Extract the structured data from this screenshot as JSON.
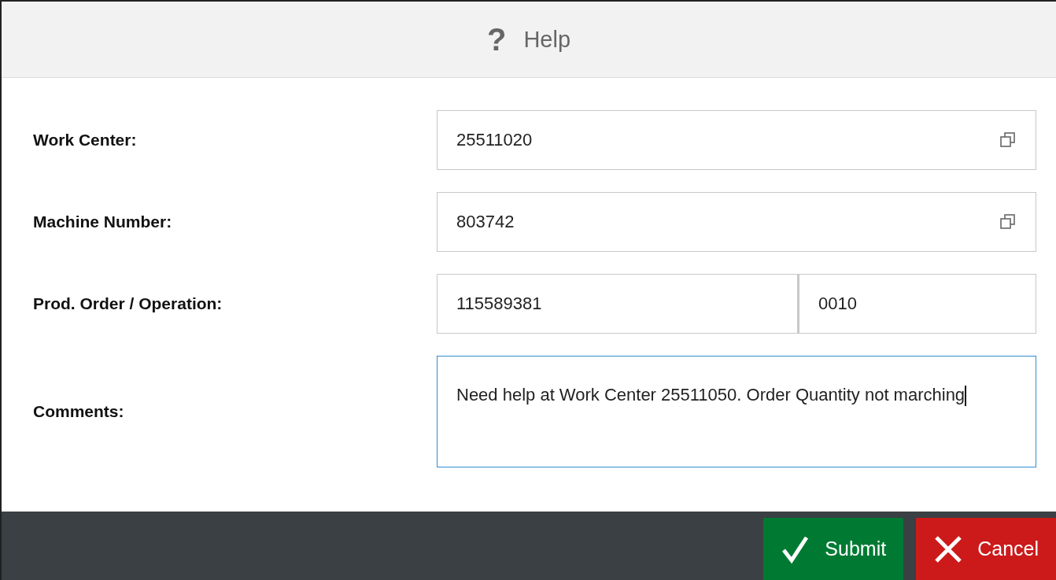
{
  "dialog": {
    "title": "Help",
    "title_icon": "?"
  },
  "fields": [
    {
      "kind": "lookup",
      "label": "Work Center:",
      "values": [
        "25511020"
      ]
    },
    {
      "kind": "lookup",
      "label": "Machine Number:",
      "values": [
        "803742"
      ]
    },
    {
      "kind": "pair",
      "label": "Prod. Order / Operation:",
      "values": [
        "115589381",
        "0010"
      ]
    },
    {
      "kind": "textarea",
      "label": "Comments:",
      "values": [
        "Need help at Work Center 25511050. Order Quantity not marching"
      ],
      "focused": true
    }
  ],
  "buttons": [
    {
      "kind": "submit",
      "label": "Submit"
    },
    {
      "kind": "cancel",
      "label": "Cancel"
    }
  ]
}
